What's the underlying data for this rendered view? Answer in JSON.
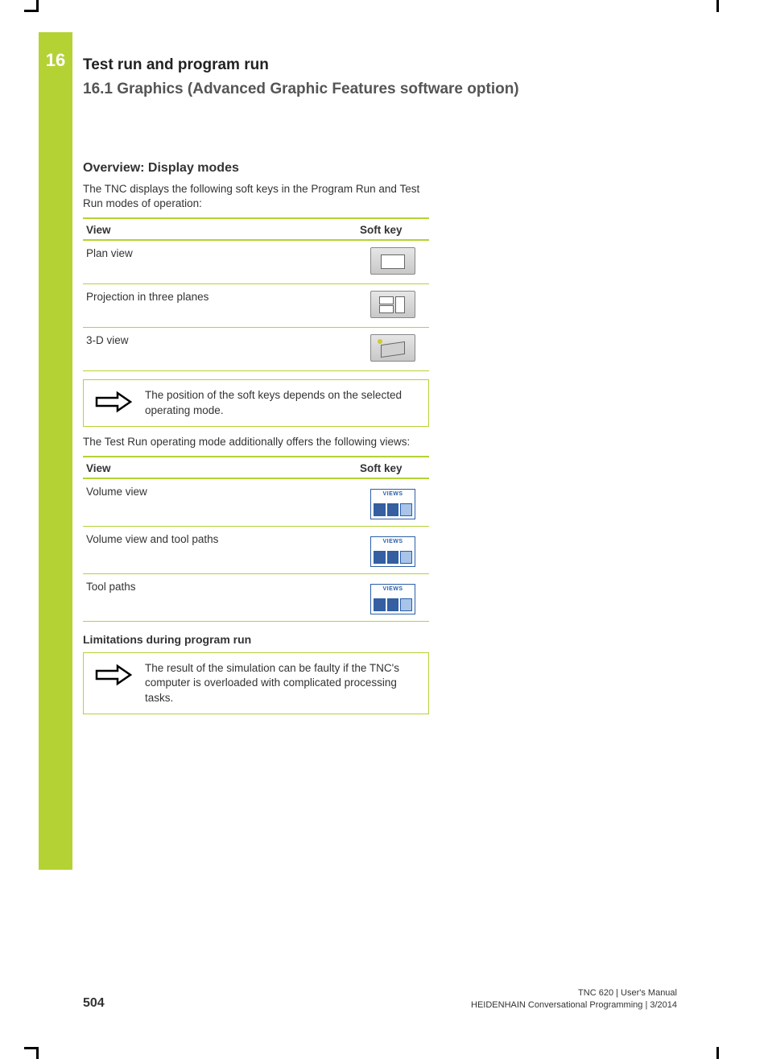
{
  "chapter": {
    "number": "16",
    "title": "Test run and program run",
    "section": "16.1   Graphics (Advanced Graphic Features software option)"
  },
  "overview": {
    "heading": "Overview: Display modes",
    "intro": "The TNC displays the following soft keys in the Program Run and Test Run modes of operation:",
    "col_view": "View",
    "col_softkey": "Soft key",
    "rows": [
      {
        "label": "Plan view"
      },
      {
        "label": "Projection in three planes"
      },
      {
        "label": "3-D view"
      }
    ]
  },
  "note1": "The position of the soft keys depends on the selected operating mode.",
  "extra_intro": "The Test Run operating mode additionally offers the following views:",
  "views2": {
    "col_view": "View",
    "col_softkey": "Soft key",
    "softkey_label": "VIEWS",
    "rows": [
      {
        "label": "Volume view"
      },
      {
        "label": "Volume view and tool paths"
      },
      {
        "label": "Tool paths"
      }
    ]
  },
  "limitations_heading": "Limitations during program run",
  "note2": "The result of the simulation can be faulty if the TNC's computer is overloaded with complicated processing tasks.",
  "footer": {
    "page": "504",
    "line1": "TNC 620 | User's Manual",
    "line2": "HEIDENHAIN Conversational Programming | 3/2014"
  }
}
